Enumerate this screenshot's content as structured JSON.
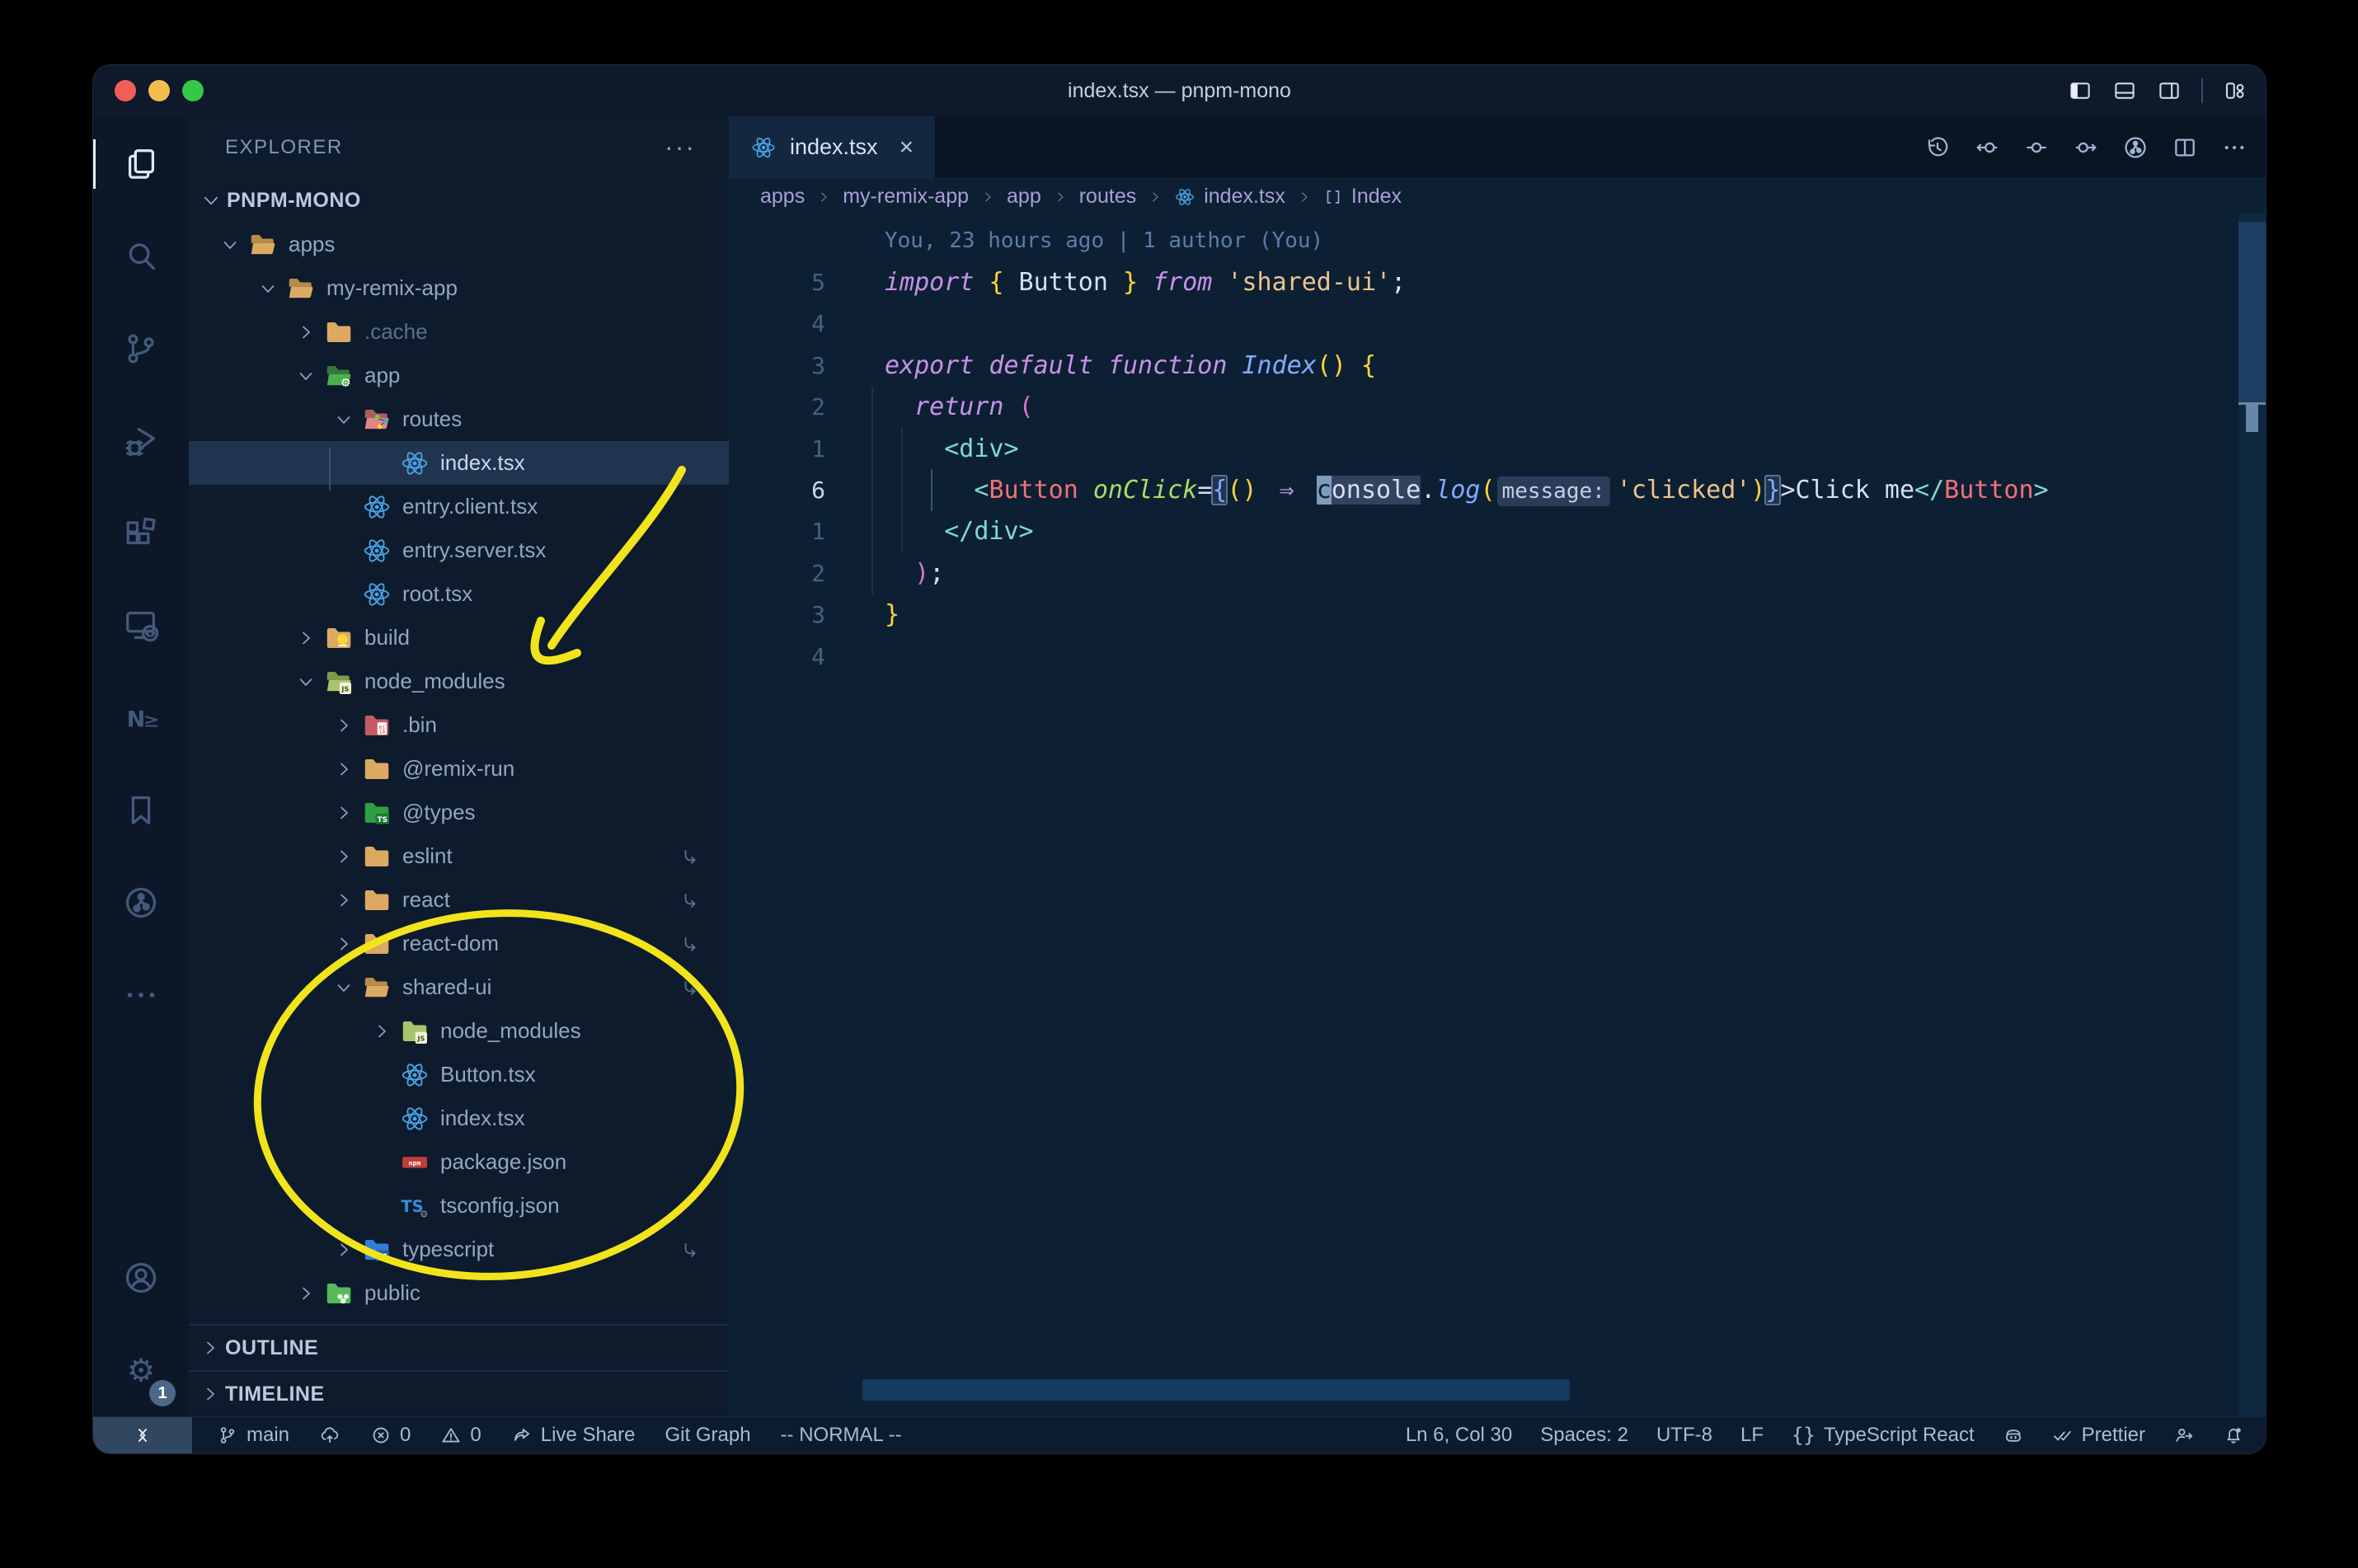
{
  "window": {
    "title": "index.tsx — pnpm-mono"
  },
  "titlebar": {
    "layout_icons": [
      "layout-sidebar-left",
      "layout-panel",
      "layout-sidebar-right",
      "sep",
      "layout-customize"
    ]
  },
  "activity_bar": {
    "items": [
      {
        "icon": "files",
        "active": true
      },
      {
        "icon": "search"
      },
      {
        "icon": "source-control"
      },
      {
        "icon": "debug"
      },
      {
        "icon": "extensions"
      },
      {
        "icon": "remote-explorer"
      },
      {
        "icon": "nx-console"
      },
      {
        "icon": "bookmarks"
      },
      {
        "icon": "gitlens"
      },
      {
        "icon": "ellipsis"
      },
      {
        "spacer": true
      },
      {
        "icon": "account"
      },
      {
        "icon": "settings-gear",
        "badge": "1"
      }
    ]
  },
  "sidebar": {
    "header": "EXPLORER",
    "header_menu": "···",
    "workspace": "PNPM-MONO",
    "tree": [
      {
        "l": "apps",
        "d": 0,
        "i": "folder-open",
        "c": "d"
      },
      {
        "l": "my-remix-app",
        "d": 1,
        "i": "folder-open",
        "c": "d"
      },
      {
        "l": ".cache",
        "d": 2,
        "i": "folder",
        "c": "r",
        "dim": true
      },
      {
        "l": "app",
        "d": 2,
        "i": "folder-app",
        "c": "d"
      },
      {
        "l": "routes",
        "d": 3,
        "i": "folder-routes",
        "c": "d"
      },
      {
        "l": "index.tsx",
        "d": 4,
        "i": "react",
        "sel": true
      },
      {
        "l": "entry.client.tsx",
        "d": 3,
        "i": "react"
      },
      {
        "l": "entry.server.tsx",
        "d": 3,
        "i": "react"
      },
      {
        "l": "root.tsx",
        "d": 3,
        "i": "react"
      },
      {
        "l": "build",
        "d": 2,
        "i": "folder-build",
        "c": "r"
      },
      {
        "l": "node_modules",
        "d": 2,
        "i": "folder-node-open",
        "c": "d"
      },
      {
        "l": ".bin",
        "d": 3,
        "i": "folder-bin",
        "c": "r"
      },
      {
        "l": "@remix-run",
        "d": 3,
        "i": "folder",
        "c": "r"
      },
      {
        "l": "@types",
        "d": 3,
        "i": "folder-types",
        "c": "r"
      },
      {
        "l": "eslint",
        "d": 3,
        "i": "folder",
        "c": "r",
        "link": true
      },
      {
        "l": "react",
        "d": 3,
        "i": "folder",
        "c": "r",
        "link": true
      },
      {
        "l": "react-dom",
        "d": 3,
        "i": "folder",
        "c": "r",
        "link": true
      },
      {
        "l": "shared-ui",
        "d": 3,
        "i": "folder-open",
        "c": "d",
        "link": true
      },
      {
        "l": "node_modules",
        "d": 4,
        "i": "folder-node",
        "c": "r"
      },
      {
        "l": "Button.tsx",
        "d": 4,
        "i": "react"
      },
      {
        "l": "index.tsx",
        "d": 4,
        "i": "react"
      },
      {
        "l": "package.json",
        "d": 4,
        "i": "npm"
      },
      {
        "l": "tsconfig.json",
        "d": 4,
        "i": "tsconfig"
      },
      {
        "l": "typescript",
        "d": 3,
        "i": "folder-typescript",
        "c": "r",
        "link": true
      },
      {
        "l": "public",
        "d": 2,
        "i": "folder-public",
        "c": "r"
      }
    ],
    "sections": [
      "OUTLINE",
      "TIMELINE"
    ]
  },
  "editor": {
    "tab": {
      "label": "index.tsx",
      "icon": "react",
      "close": "×"
    },
    "toolbar": [
      "history",
      "change-prev",
      "change",
      "change-next",
      "gitlens",
      "split-editor",
      "ellipsis"
    ],
    "breadcrumbs": [
      {
        "label": "apps"
      },
      {
        "label": "my-remix-app"
      },
      {
        "label": "app"
      },
      {
        "label": "routes"
      },
      {
        "label": "index.tsx",
        "icon": "react"
      },
      {
        "label": "Index",
        "icon": "symbol-module"
      }
    ],
    "blame": "You, 23 hours ago | 1 author (You)",
    "lines": [
      {
        "n": "5",
        "segs": [
          [
            "import",
            "kw"
          ],
          [
            " "
          ],
          [
            "{",
            "b1"
          ],
          [
            " Button ",
            "fg"
          ],
          [
            "}",
            "b1"
          ],
          [
            " "
          ],
          [
            "from",
            "kw"
          ],
          [
            " "
          ],
          [
            "'shared-ui'",
            "str"
          ],
          [
            ";",
            "fg"
          ]
        ]
      },
      {
        "n": "4",
        "segs": []
      },
      {
        "n": "3",
        "segs": [
          [
            "export",
            "kw"
          ],
          [
            " "
          ],
          [
            "default",
            "kw"
          ],
          [
            " "
          ],
          [
            "function",
            "kw"
          ],
          [
            " "
          ],
          [
            "Index",
            "fn"
          ],
          [
            "()",
            "b1"
          ],
          [
            " "
          ],
          [
            "{",
            "b1"
          ]
        ]
      },
      {
        "n": "2",
        "segs": [
          [
            "  "
          ],
          [
            "return",
            "kw"
          ],
          [
            " "
          ],
          [
            "(",
            "b2"
          ]
        ]
      },
      {
        "n": "1",
        "segs": [
          [
            "    "
          ],
          [
            "<div>",
            "tag"
          ]
        ]
      },
      {
        "n": "6",
        "current": true,
        "segs": [
          [
            "      "
          ],
          [
            "<",
            "tag"
          ],
          [
            "Button",
            "comp"
          ],
          [
            " "
          ],
          [
            "onClick",
            "attr"
          ],
          [
            "=",
            "fg"
          ],
          [
            "{",
            "b3x"
          ],
          [
            "()",
            "b1"
          ],
          [
            " "
          ],
          [
            "⇒",
            "lig"
          ],
          [
            " "
          ],
          [
            "c",
            "cur"
          ],
          [
            "onsole",
            "hlw"
          ],
          [
            ".",
            "fg"
          ],
          [
            "log",
            "fn"
          ],
          [
            "(",
            "b1"
          ],
          [
            "message:",
            "inlay"
          ],
          [
            "'clicked'",
            "str"
          ],
          [
            ")",
            "b1"
          ],
          [
            "}",
            "b3x"
          ],
          [
            ">",
            "fg"
          ],
          [
            "Click me",
            "fg"
          ],
          [
            "</",
            "tag"
          ],
          [
            "Button",
            "comp"
          ],
          [
            ">",
            "tag"
          ]
        ]
      },
      {
        "n": "1",
        "segs": [
          [
            "    "
          ],
          [
            "</div>",
            "tag"
          ]
        ]
      },
      {
        "n": "2",
        "segs": [
          [
            "  "
          ],
          [
            ")",
            "b2"
          ],
          [
            ";",
            "fg"
          ]
        ]
      },
      {
        "n": "3",
        "segs": [
          [
            "}",
            "b1"
          ]
        ]
      },
      {
        "n": "4",
        "segs": []
      }
    ]
  },
  "status_bar": {
    "left": [
      {
        "icon": "remote-indicator",
        "seg": true
      },
      {
        "icon": "git-branch",
        "label": "main"
      },
      {
        "icon": "cloud-upload"
      },
      {
        "icon": "error-circle",
        "label": "0"
      },
      {
        "icon": "warning-triangle",
        "label": "0"
      },
      {
        "icon": "live-share",
        "label": "Live Share"
      },
      {
        "label": "Git Graph"
      },
      {
        "label": "-- NORMAL --"
      }
    ],
    "right": [
      {
        "label": "Ln 6, Col 30"
      },
      {
        "label": "Spaces: 2"
      },
      {
        "label": "UTF-8"
      },
      {
        "label": "LF"
      },
      {
        "icon": "braces",
        "label": "TypeScript React"
      },
      {
        "icon": "copilot"
      },
      {
        "icon": "double-check",
        "label": "Prettier"
      },
      {
        "icon": "person-feedback"
      },
      {
        "icon": "bell-dot"
      }
    ]
  },
  "colors": {
    "annotation": "#f2e41c",
    "react_blue": "#4aa3e3",
    "folder_tan": "#dca963",
    "folder_tan_dark": "#b98a49",
    "folder_green": "#4caf50",
    "folder_salmon": "#e08585",
    "folder_olive": "#a9c46c",
    "folder_red": "#c45b66",
    "folder_blue": "#2f7fd6",
    "npm_red": "#c13b3b",
    "selection_row": "#20344f"
  }
}
